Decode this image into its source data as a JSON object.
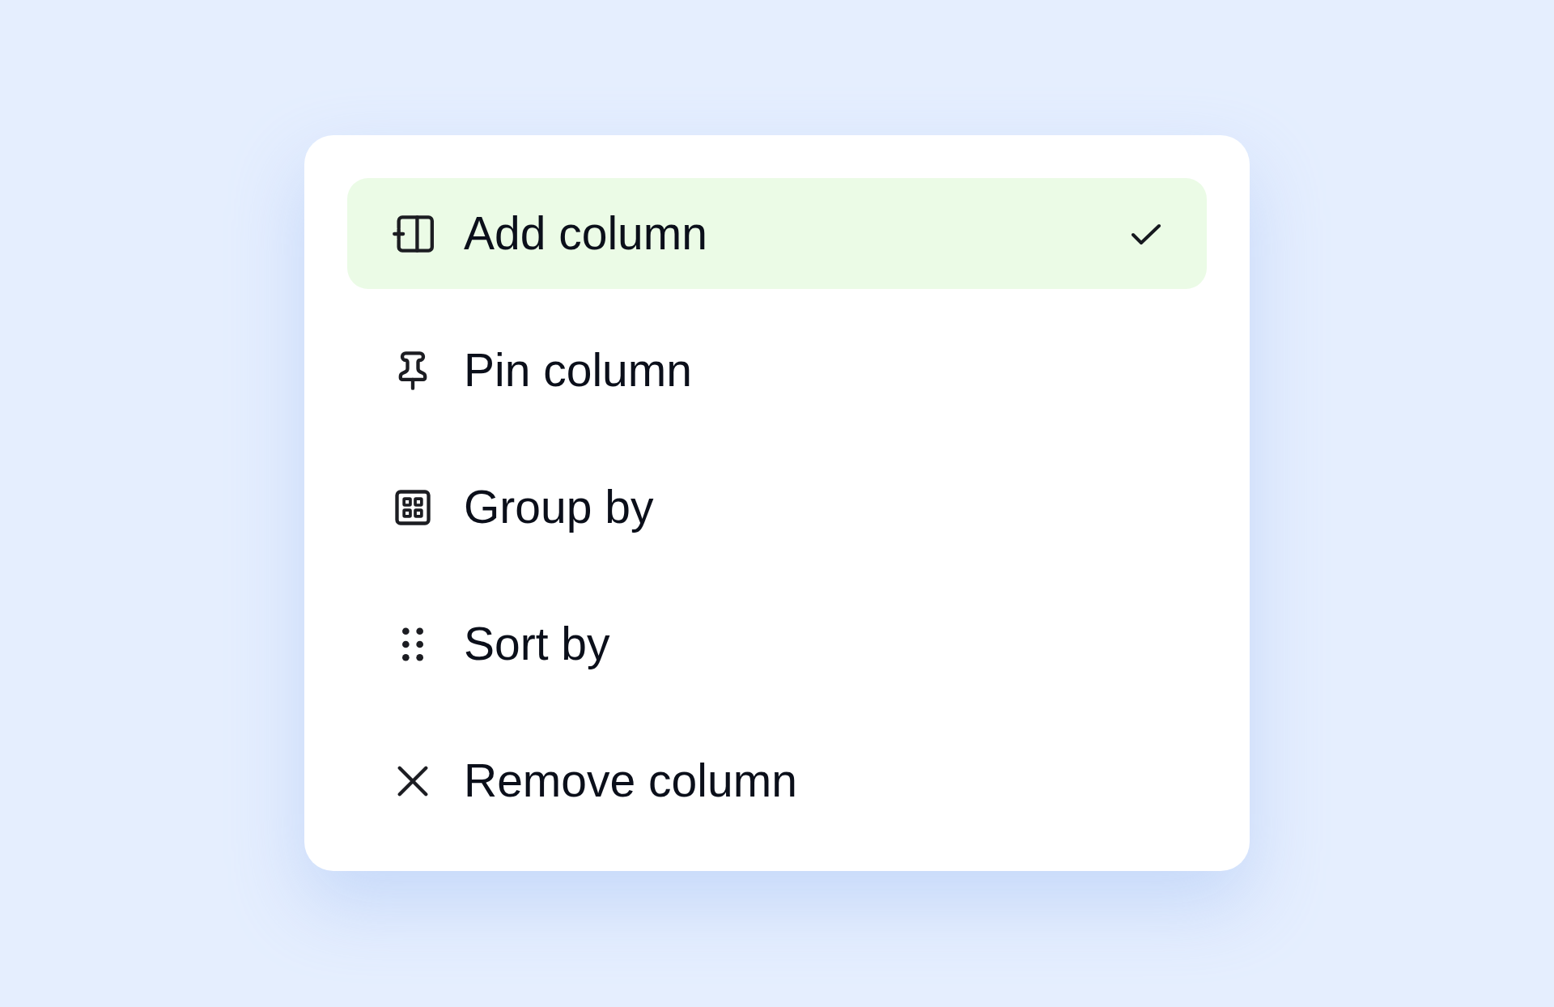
{
  "menu": {
    "items": [
      {
        "kind": "add",
        "label": "Add column",
        "selected": true
      },
      {
        "kind": "pin",
        "label": "Pin column",
        "selected": false
      },
      {
        "kind": "group",
        "label": "Group by",
        "selected": false
      },
      {
        "kind": "sort",
        "label": "Sort by",
        "selected": false
      },
      {
        "kind": "remove",
        "label": "Remove column",
        "selected": false
      }
    ]
  }
}
